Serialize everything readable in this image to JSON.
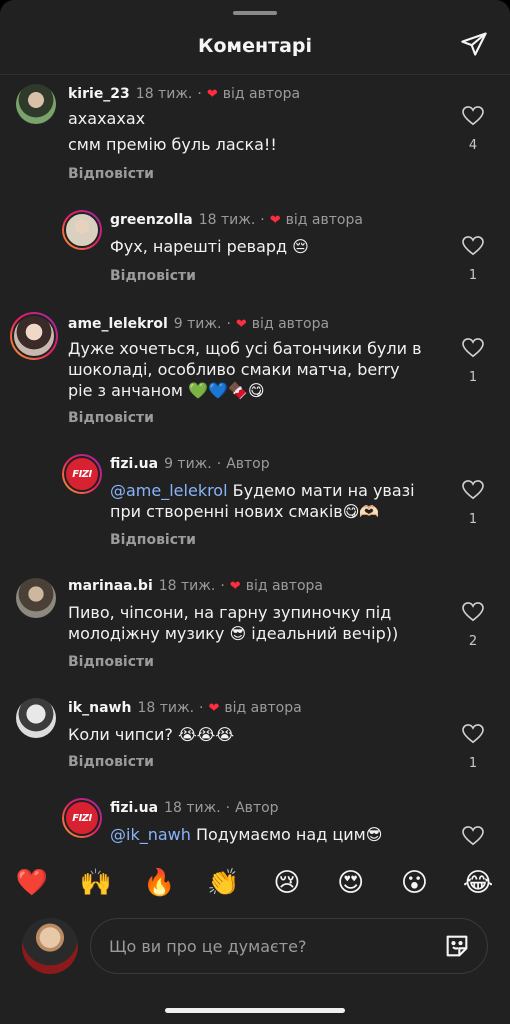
{
  "header": {
    "title": "Коментарі"
  },
  "comments": [
    {
      "username": "kirie_23",
      "time": "18 тиж.",
      "by_author": "від автора",
      "lines": [
        "ахахахах",
        "смм премію буль ласка!!"
      ],
      "reply": "Відповісти",
      "likes": "4"
    },
    {
      "username": "greenzolla",
      "time": "18 тиж.",
      "by_author": "від автора",
      "lines": [
        "Фух, нарешті ревард 😔"
      ],
      "reply": "Відповісти",
      "likes": "1"
    },
    {
      "username": "ame_lelekrol",
      "time": "9 тиж.",
      "by_author": "від автора",
      "lines": [
        "Дуже хочеться, щоб усі батончики були в",
        "шоколаді, особливо смаки матча, berry",
        "pie з анчаном 💚💙🍫😋"
      ],
      "reply": "Відповісти",
      "likes": "1"
    },
    {
      "username": "fizi.ua",
      "time": "9 тиж.",
      "author_tag": "Автор",
      "mention": "@ame_lelekrol",
      "lines": [
        " Будемо мати на увазі",
        "при створенні нових смаків😋🫶🏻"
      ],
      "reply": "Відповісти",
      "likes": "1"
    },
    {
      "username": "marinaa.bi",
      "time": "18 тиж.",
      "by_author": "від автора",
      "lines": [
        "Пиво, чіпсони, на гарну зупиночку під",
        "молодіжну музику 😎 ідеальний вечір))"
      ],
      "reply": "Відповісти",
      "likes": "2"
    },
    {
      "username": "ik_nawh",
      "time": "18 тиж.",
      "by_author": "від автора",
      "lines": [
        "Коли чипси? 😭😭😭"
      ],
      "reply": "Відповісти",
      "likes": "1"
    },
    {
      "username": "fizi.ua",
      "time": "18 тиж.",
      "author_tag": "Автор",
      "mention": "@ik_nawh",
      "lines": [
        " Подумаємо над цим😎"
      ]
    }
  ],
  "fizi_logo_text": "FIZI",
  "emoji_bar": [
    "❤️",
    "🙌",
    "🔥",
    "👏",
    "😢",
    "😍",
    "😮",
    "😂"
  ],
  "input": {
    "placeholder": "Що ви про це думаєте?"
  },
  "icons": {
    "share": "send-icon",
    "like": "heart-outline-icon",
    "sticker": "sticker-icon"
  }
}
